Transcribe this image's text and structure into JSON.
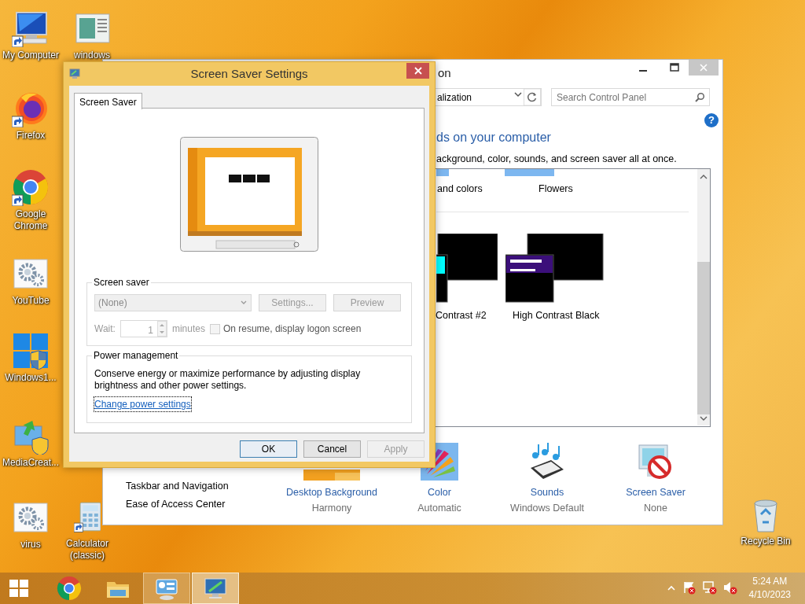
{
  "desktop_icons": [
    {
      "label": "My Computer",
      "kind": "computer",
      "shortcut": true
    },
    {
      "label": "windows",
      "kind": "document",
      "shortcut": false
    },
    {
      "label": "Firefox",
      "kind": "firefox",
      "shortcut": true
    },
    {
      "label": "Google Chrome",
      "kind": "chrome",
      "shortcut": true
    },
    {
      "label": "YouTube",
      "kind": "gears",
      "shortcut": false
    },
    {
      "label": "Windows1...",
      "kind": "windows-shield",
      "shortcut": false
    },
    {
      "label": "MediaCreat...",
      "kind": "media",
      "shortcut": false
    },
    {
      "label": "virus",
      "kind": "gears",
      "shortcut": false
    },
    {
      "label": "Calculator (classic)",
      "kind": "calculator",
      "shortcut": true
    },
    {
      "label": "Recycle Bin",
      "kind": "recycle-bin",
      "shortcut": false
    }
  ],
  "control_panel_window": {
    "title": "on",
    "address": "alization",
    "search": {
      "placeholder": "Search Control Panel"
    },
    "help": "?",
    "heading": "ds on your computer",
    "subtitle": "ackground, color, sounds, and screen saver all at once.",
    "theme_groups": [
      {
        "label": "and colors"
      },
      {
        "label": "Flowers"
      }
    ],
    "themes": [
      {
        "label": "Contrast #2",
        "kind": "contrast-2"
      },
      {
        "label": "High Contrast Black",
        "kind": "contrast-black"
      }
    ],
    "see_also": [
      "Taskbar and Navigation",
      "Ease of Access Center"
    ],
    "settings": [
      {
        "label": "Desktop Background",
        "value": "Harmony",
        "kind": "background"
      },
      {
        "label": "Color",
        "value": "Automatic",
        "kind": "color"
      },
      {
        "label": "Sounds",
        "value": "Windows Default",
        "kind": "sounds"
      },
      {
        "label": "Screen Saver",
        "value": "None",
        "kind": "screen-saver"
      }
    ]
  },
  "dialog": {
    "title": "Screen Saver Settings",
    "tabs": [
      {
        "label": "Screen Saver",
        "selected": true
      }
    ],
    "screen_saver": {
      "legend": "Screen saver",
      "value": "(None)",
      "disabled": true,
      "buttons": [
        {
          "label": "Settings...",
          "disabled": true
        },
        {
          "label": "Preview",
          "disabled": true
        }
      ],
      "wait_label": "Wait:",
      "wait_value": "1",
      "unit": "minutes",
      "checkbox": {
        "label": "On resume, display logon screen",
        "checked": false,
        "disabled": true
      }
    },
    "power": {
      "legend": "Power management",
      "text": "Conserve energy or maximize performance by adjusting display brightness and other power settings.",
      "link": "Change power settings",
      "link_focused": true
    },
    "buttons": [
      {
        "label": "OK",
        "default": true,
        "disabled": false
      },
      {
        "label": "Cancel",
        "default": false,
        "disabled": false
      },
      {
        "label": "Apply",
        "default": false,
        "disabled": true
      }
    ]
  },
  "taskbar": {
    "items": [
      {
        "kind": "chrome",
        "open": false,
        "selected": false
      },
      {
        "kind": "explorer",
        "open": false,
        "selected": false
      },
      {
        "kind": "control-panel",
        "open": true,
        "selected": false
      },
      {
        "kind": "screen-saver",
        "open": true,
        "selected": true
      }
    ],
    "clock": {
      "time": "5:24 AM",
      "date": "4/10/2023"
    }
  }
}
